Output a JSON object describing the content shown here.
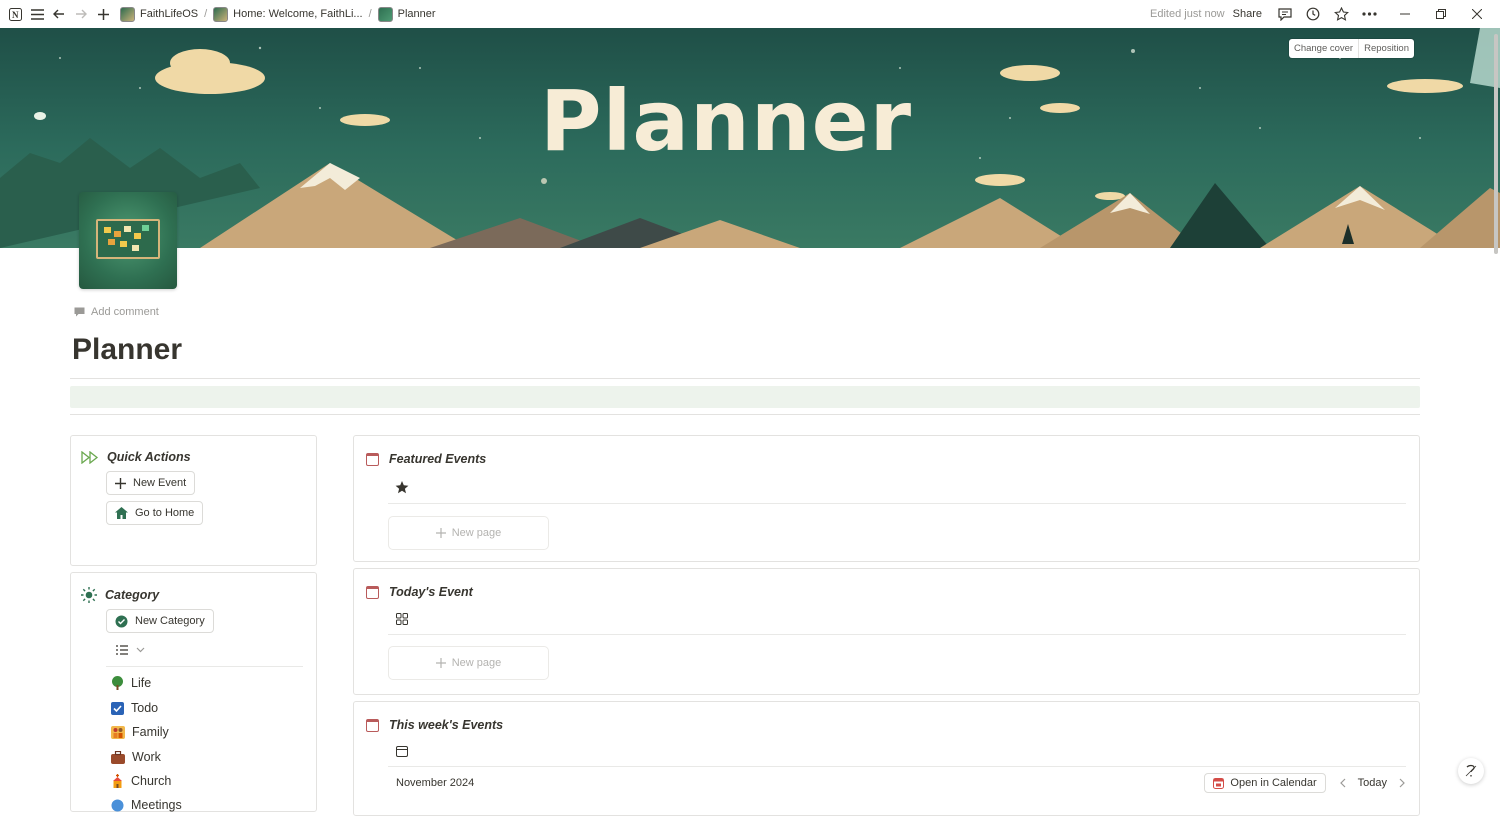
{
  "topbar": {
    "breadcrumbs": [
      {
        "label": "FaithLifeOS"
      },
      {
        "label": "Home: Welcome, FaithLi..."
      },
      {
        "label": "Planner"
      }
    ],
    "edited": "Edited just now",
    "share": "Share"
  },
  "cover": {
    "title": "Planner",
    "change_cover": "Change cover",
    "reposition": "Reposition"
  },
  "page": {
    "add_comment": "Add comment",
    "title": "Planner"
  },
  "quick_actions": {
    "title": "Quick Actions",
    "buttons": [
      "New Event",
      "Go to Home"
    ]
  },
  "category": {
    "title": "Category",
    "new_button": "New Category",
    "items": [
      {
        "label": "Life",
        "icon": "tree-icon"
      },
      {
        "label": "Todo",
        "icon": "checkbox-icon"
      },
      {
        "label": "Family",
        "icon": "family-icon"
      },
      {
        "label": "Work",
        "icon": "briefcase-icon"
      },
      {
        "label": "Church",
        "icon": "church-icon"
      },
      {
        "label": "Meetings",
        "icon": "meeting-icon"
      }
    ]
  },
  "featured": {
    "title": "Featured Events",
    "new_page": "New page"
  },
  "today": {
    "title": "Today's Event",
    "new_page": "New page"
  },
  "week": {
    "title": "This week's Events",
    "month": "November 2024",
    "open_calendar": "Open in Calendar",
    "today": "Today"
  },
  "colors": {
    "accent_green": "#2f7052",
    "callout_bg": "#edf3ec",
    "calendar_red": "#b95b5b"
  }
}
